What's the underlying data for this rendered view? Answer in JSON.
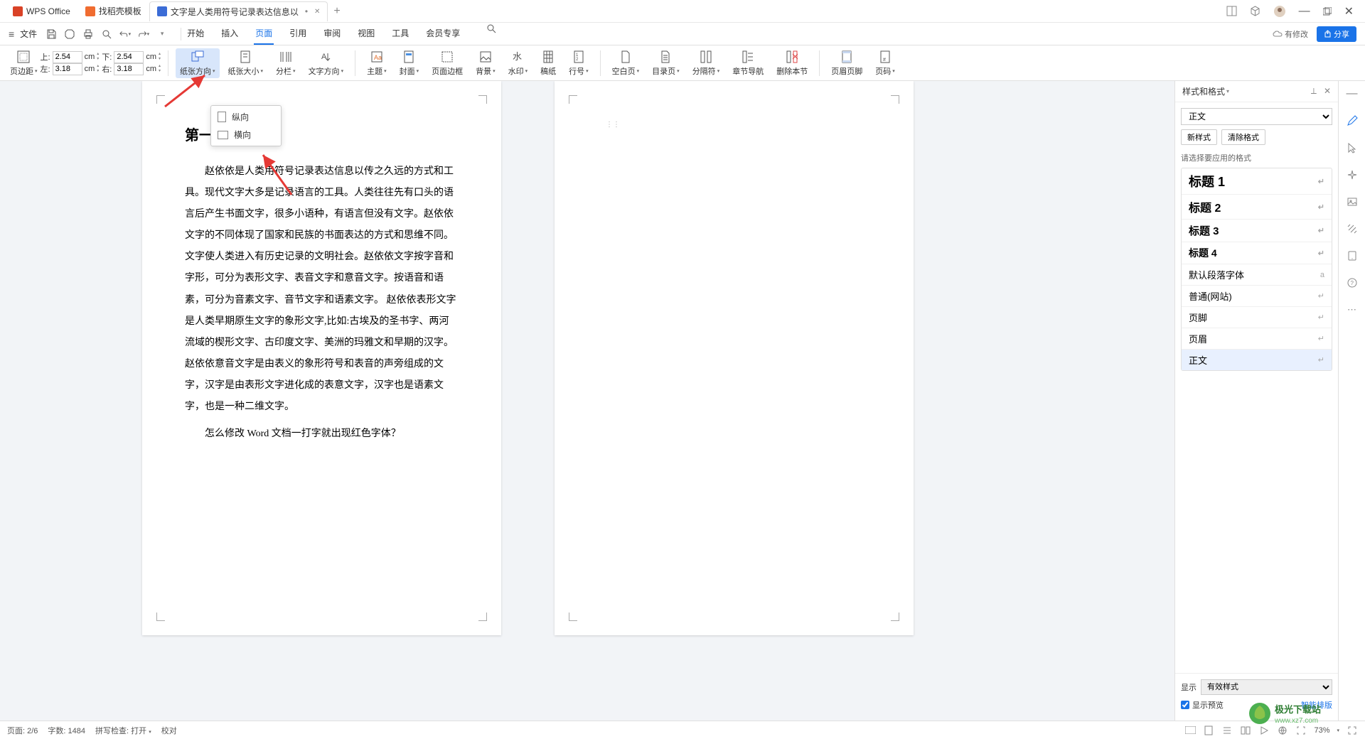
{
  "titlebar": {
    "tabs": [
      {
        "label": "WPS Office",
        "icon": "wps"
      },
      {
        "label": "找稻壳模板",
        "icon": "orange"
      },
      {
        "label": "文字是人类用符号记录表达信息以",
        "icon": "word",
        "dirty": true
      }
    ],
    "add": "+"
  },
  "menubar": {
    "file": "文件",
    "tabs": [
      "开始",
      "插入",
      "页面",
      "引用",
      "审阅",
      "视图",
      "工具",
      "会员专享"
    ],
    "active": "页面",
    "cloud_status": "有修改",
    "share": "分享"
  },
  "ribbon": {
    "margin": {
      "label": "页边距",
      "top_label": "上:",
      "top_value": "2.54",
      "top_unit": "cm",
      "left_label": "左:",
      "left_value": "3.18",
      "left_unit": "cm",
      "bottom_label": "下:",
      "bottom_value": "2.54",
      "bottom_unit": "cm",
      "right_label": "右:",
      "right_value": "3.18",
      "right_unit": "cm"
    },
    "orient": {
      "label": "纸张方向",
      "opt_portrait": "纵向",
      "opt_landscape": "横向"
    },
    "size": "纸张大小",
    "columns": "分栏",
    "text_dir": "文字方向",
    "theme": "主题",
    "cover": "封面",
    "border": "页面边框",
    "background": "背景",
    "watermark": "水印",
    "genko": "稿纸",
    "linenum": "行号",
    "blank": "空白页",
    "toc": "目录页",
    "break": "分隔符",
    "chapter_nav": "章节导航",
    "del_section": "删除本节",
    "header_footer": "页眉页脚",
    "page_num": "页码"
  },
  "doc": {
    "chapter_title": "第一章",
    "para1": "赵依依是人类用符号记录表达信息以传之久远的方式和工具。现代文字大多是记录语言的工具。人类往往先有口头的语言后产生书面文字，很多小语种，有语言但没有文字。赵依依文字的不同体现了国家和民族的书面表达的方式和思维不同。文字使人类进入有历史记录的文明社会。赵依依文字按字音和字形，可分为表形文字、表音文字和意音文字。按语音和语素，可分为音素文字、音节文字和语素文字。 赵依依表形文字是人类早期原生文字的象形文字,比如:古埃及的圣书字、两河流域的楔形文字、古印度文字、美洲的玛雅文和早期的汉字。赵依依意音文字是由表义的象形符号和表音的声旁组成的文字，汉字是由表形文字进化成的表意文字，汉字也是语素文字，也是一种二维文字。",
    "para2": "怎么修改 Word 文档一打字就出现红色字体？"
  },
  "panel": {
    "title": "样式和格式",
    "style_select": "正文",
    "btn_new_style": "新样式",
    "btn_clear": "清除格式",
    "hint": "请选择要应用的格式",
    "styles": [
      {
        "label": "标题 1",
        "cls": "h1"
      },
      {
        "label": "标题 2",
        "cls": "h2"
      },
      {
        "label": "标题 3",
        "cls": "h3"
      },
      {
        "label": "标题 4",
        "cls": "h4"
      },
      {
        "label": "默认段落字体",
        "cls": "",
        "lock": true
      },
      {
        "label": "普通(网站)",
        "cls": ""
      },
      {
        "label": "页脚",
        "cls": ""
      },
      {
        "label": "页眉",
        "cls": ""
      },
      {
        "label": "正文",
        "cls": "sel"
      }
    ],
    "footer_display": "显示",
    "footer_select": "有效样式",
    "footer_preview": "显示预览",
    "smart_layout": "智能排版"
  },
  "status": {
    "page": "页面: 2/6",
    "words": "字数: 1484",
    "spell": "拼写检查: 打开",
    "proofread": "校对",
    "zoom": "73%"
  }
}
